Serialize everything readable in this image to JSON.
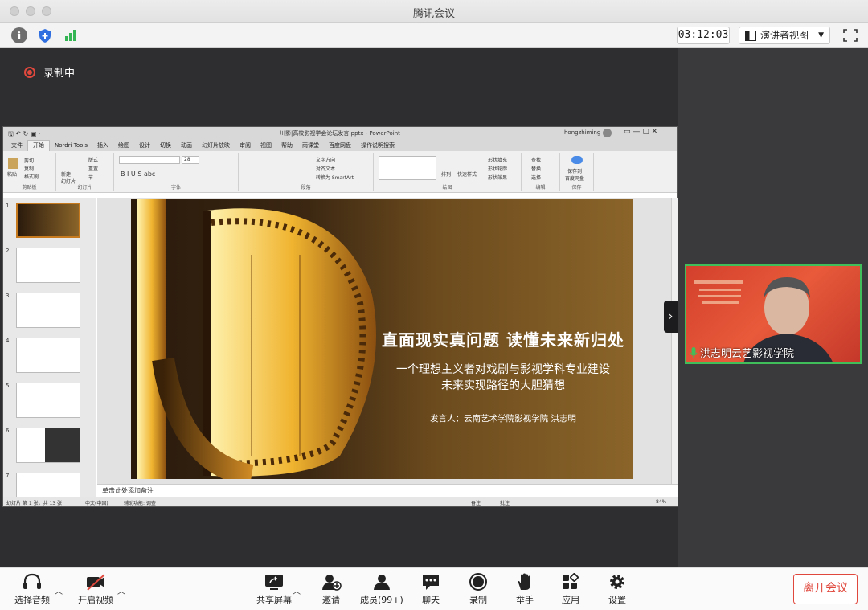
{
  "app": {
    "title": "腾讯会议"
  },
  "toolbar": {
    "timer": "03:12:03",
    "view_label": "演讲者视图"
  },
  "recording": {
    "label": "录制中"
  },
  "ppt": {
    "filename": "川影|高校影视学会论坛发言.pptx - PowerPoint",
    "user": "hongzhiming",
    "menu": [
      "文件",
      "开始",
      "Nordri Tools",
      "插入",
      "绘图",
      "设计",
      "切换",
      "动画",
      "幻灯片放映",
      "审阅",
      "视图",
      "帮助",
      "雨课堂",
      "百度网盘",
      "操作说明搜索"
    ],
    "active_menu": "开始",
    "groups": [
      "剪贴板",
      "幻灯片",
      "字体",
      "段落",
      "绘图",
      "编辑",
      "保存"
    ],
    "ribbon_labels": {
      "paste": "粘贴",
      "cut": "剪切",
      "copy": "复制",
      "format": "格式刷",
      "new_slide": "新建\n幻灯片",
      "layout": "版式",
      "reset": "重置",
      "section": "节",
      "font_size": "28",
      "text_dir": "文字方向",
      "align_text": "对齐文本",
      "smartart": "转换为 SmartArt",
      "arrange": "排列",
      "quick_styles": "快速样式",
      "fill": "形状填充",
      "outline": "形状轮廓",
      "effects": "形状效果",
      "find": "查找",
      "replace": "替换",
      "select": "选择",
      "save_baidu": "保存到\n百度网盘"
    },
    "notes_placeholder": "单击此处添加备注",
    "status_left": "幻灯片 第 1 张，共 13 张",
    "status_lang": "中文(中国)",
    "status_access": "辅助功能: 调查",
    "status_notes": "备注",
    "status_comments": "批注",
    "zoom": "84%",
    "thumbnails": [
      "1",
      "2",
      "3",
      "4",
      "5",
      "6",
      "7"
    ]
  },
  "slide": {
    "title": "直面现实真问题 读懂未来新归处",
    "subtitle_line1": "一个理想主义者对戏剧与影视学科专业建设",
    "subtitle_line2": "未来实现路径的大胆猜想",
    "presenter": "发言人：云南艺术学院影视学院  洪志明"
  },
  "video": {
    "name": "洪志明云艺影视学院"
  },
  "bottom": {
    "audio": "选择音频",
    "video": "开启视频",
    "share": "共享屏幕",
    "invite": "邀请",
    "members": "成员(99+)",
    "chat": "聊天",
    "record": "录制",
    "raise": "举手",
    "apps": "应用",
    "settings": "设置",
    "leave": "离开会议"
  },
  "colors": {
    "accent": "#3fbe5a",
    "leave": "#e0483d",
    "record": "#e0483d"
  }
}
